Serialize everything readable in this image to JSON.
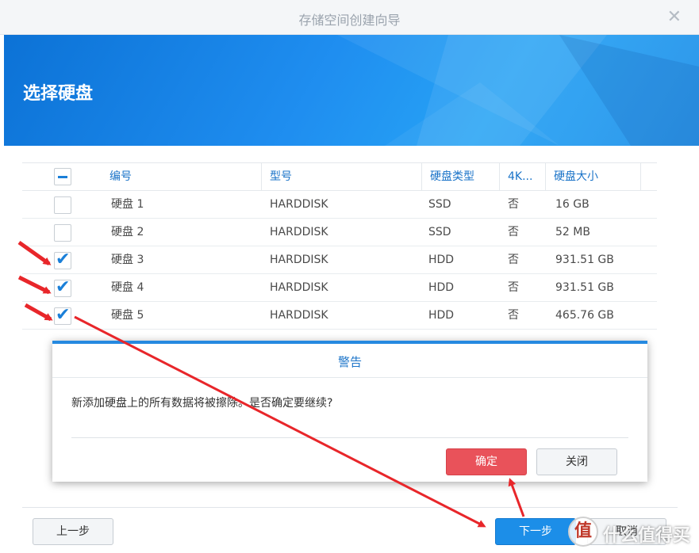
{
  "window": {
    "title": "存储空间创建向导",
    "close_glyph": "✕"
  },
  "banner": {
    "heading": "选择硬盘"
  },
  "table": {
    "headers": [
      "编号",
      "型号",
      "硬盘类型",
      "4K...",
      "硬盘大小"
    ],
    "rows": [
      {
        "checked": false,
        "id": "硬盘 1",
        "model": "HARDDISK",
        "type": "SSD",
        "fourk": "否",
        "size": "16 GB"
      },
      {
        "checked": false,
        "id": "硬盘 2",
        "model": "HARDDISK",
        "type": "SSD",
        "fourk": "否",
        "size": "52 MB"
      },
      {
        "checked": true,
        "id": "硬盘 3",
        "model": "HARDDISK",
        "type": "HDD",
        "fourk": "否",
        "size": "931.51 GB"
      },
      {
        "checked": true,
        "id": "硬盘 4",
        "model": "HARDDISK",
        "type": "HDD",
        "fourk": "否",
        "size": "931.51 GB"
      },
      {
        "checked": true,
        "id": "硬盘 5",
        "model": "HARDDISK",
        "type": "HDD",
        "fourk": "否",
        "size": "465.76 GB"
      }
    ]
  },
  "dialog": {
    "title": "警告",
    "message": "新添加硬盘上的所有数据将被擦除。是否确定要继续?",
    "confirm_label": "确定",
    "close_label": "关闭"
  },
  "footer": {
    "prev_label": "上一步",
    "next_label": "下一步",
    "cancel_label": "取消"
  },
  "watermark": {
    "icon": "值",
    "text": "什么值得买"
  },
  "colors": {
    "accent": "#1c8ee8",
    "danger": "#e9525a",
    "annotation": "#e8262a"
  },
  "check_glyph": "✔"
}
